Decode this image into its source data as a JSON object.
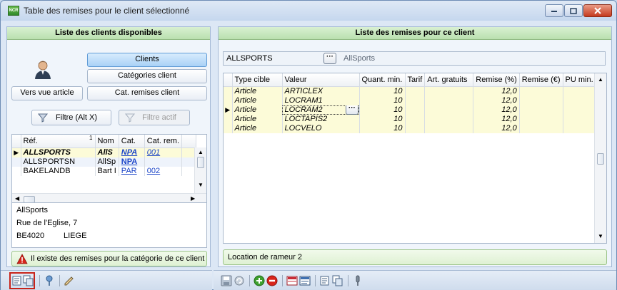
{
  "window": {
    "title": "Table des remises pour le client sélectionné",
    "app_icon_text": "NCR"
  },
  "left": {
    "header": "Liste des clients disponibles",
    "buttons": {
      "clients": "Clients",
      "categories": "Catégories client",
      "vers_vue": "Vers vue article",
      "cat_remises": "Cat. remises client",
      "filtre": "Filtre (Alt X)",
      "filtre_actif": "Filtre actif"
    },
    "grid": {
      "columns": [
        "Réf.",
        "Nom",
        "Cat.",
        "Cat. rem."
      ],
      "sort_indicator": "1",
      "rows": [
        {
          "ref": "ALLSPORTS",
          "nom": "AllS",
          "cat": "NPA",
          "catrem": "001",
          "selected": true
        },
        {
          "ref": "ALLSPORTSN",
          "nom": "AllSp",
          "cat": "NPA",
          "catrem": "",
          "selected": false
        },
        {
          "ref": "BAKELANDB",
          "nom": "Bart I",
          "cat": "PAR",
          "catrem": "002",
          "selected": false
        }
      ]
    },
    "address": {
      "name": "AllSports",
      "street": "Rue de l'Eglise, 7",
      "postal": "BE4020",
      "city": "LIEGE"
    },
    "notice": "Il existe des remises pour la catégorie de ce client"
  },
  "right": {
    "header": "Liste des remises pour ce client",
    "client_code": "ALLSPORTS",
    "client_name": "AllSports",
    "grid": {
      "columns": [
        "Type cible",
        "Valeur",
        "Quant. min.",
        "Tarif",
        "Art. gratuits",
        "Remise (%)",
        "Remise (€)",
        "PU min."
      ],
      "rows": [
        {
          "type": "Article",
          "valeur": "ARTICLEX",
          "qmin": "10",
          "remise_pct": "12,0"
        },
        {
          "type": "Article",
          "valeur": "LOCRAM1",
          "qmin": "10",
          "remise_pct": "12,0"
        },
        {
          "type": "Article",
          "valeur": "LOCRAM2",
          "qmin": "10",
          "remise_pct": "12,0"
        },
        {
          "type": "Article",
          "valeur": "LOCTAPIS2",
          "qmin": "10",
          "remise_pct": "12,0"
        },
        {
          "type": "Article",
          "valeur": "LOCVELO",
          "qmin": "10",
          "remise_pct": "12,0"
        }
      ]
    },
    "description": "Location de rameur 2"
  },
  "colors": {
    "header_green": "#c7e7bc",
    "selected_row": "#fcfbd8",
    "link_blue": "#1a44c8",
    "active_button": "#a9d1f6"
  }
}
